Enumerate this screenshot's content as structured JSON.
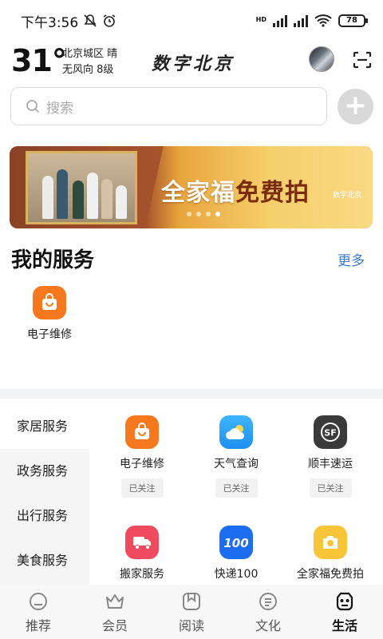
{
  "status_bar": {
    "time": "下午3:56",
    "battery": "78",
    "network": "HD"
  },
  "header": {
    "temperature": "31°",
    "location_weather": "北京城区 晴",
    "wind": "无风向 8级",
    "logo_text": "数字北京"
  },
  "search": {
    "placeholder": "搜索"
  },
  "banner": {
    "text_main": "全家福",
    "text_accent": "免费拍",
    "brand": "数字北京",
    "page_dots": 4,
    "active_dot": 3
  },
  "my_services": {
    "title": "我的服务",
    "more_label": "更多",
    "items": [
      {
        "label": "电子维修",
        "icon": "shopping-bag-icon",
        "color": "#f5781f"
      }
    ]
  },
  "categories": [
    {
      "label": "家居服务",
      "active": true
    },
    {
      "label": "政务服务",
      "active": false
    },
    {
      "label": "出行服务",
      "active": false
    },
    {
      "label": "美食服务",
      "active": false
    }
  ],
  "service_grid": [
    {
      "label": "电子维修",
      "icon": "shopping-bag-icon",
      "color": "#f5781f",
      "badge": "已关注"
    },
    {
      "label": "天气查询",
      "icon": "cloud-icon",
      "color": "#2aa3f5",
      "badge": "已关注"
    },
    {
      "label": "顺丰速运",
      "icon": "sf-express-icon",
      "color": "#3a3a3a",
      "badge": "已关注"
    },
    {
      "label": "搬家服务",
      "icon": "moving-truck-icon",
      "color": "#ef4a5e",
      "badge": ""
    },
    {
      "label": "快递100",
      "icon": "kuaidi100-icon",
      "color": "#1d6df0",
      "badge": ""
    },
    {
      "label": "全家福免费拍",
      "icon": "camera-icon",
      "color": "#f8c53a",
      "badge": ""
    }
  ],
  "tab_bar": [
    {
      "label": "推荐",
      "icon": "recommend-icon",
      "active": false
    },
    {
      "label": "会员",
      "icon": "crown-icon",
      "active": false
    },
    {
      "label": "阅读",
      "icon": "book-icon",
      "active": false
    },
    {
      "label": "文化",
      "icon": "culture-icon",
      "active": false
    },
    {
      "label": "生活",
      "icon": "life-icon",
      "active": true
    }
  ],
  "colors": {
    "accent_link": "#3a7bd5",
    "plus_button": "#d9d9d9"
  }
}
